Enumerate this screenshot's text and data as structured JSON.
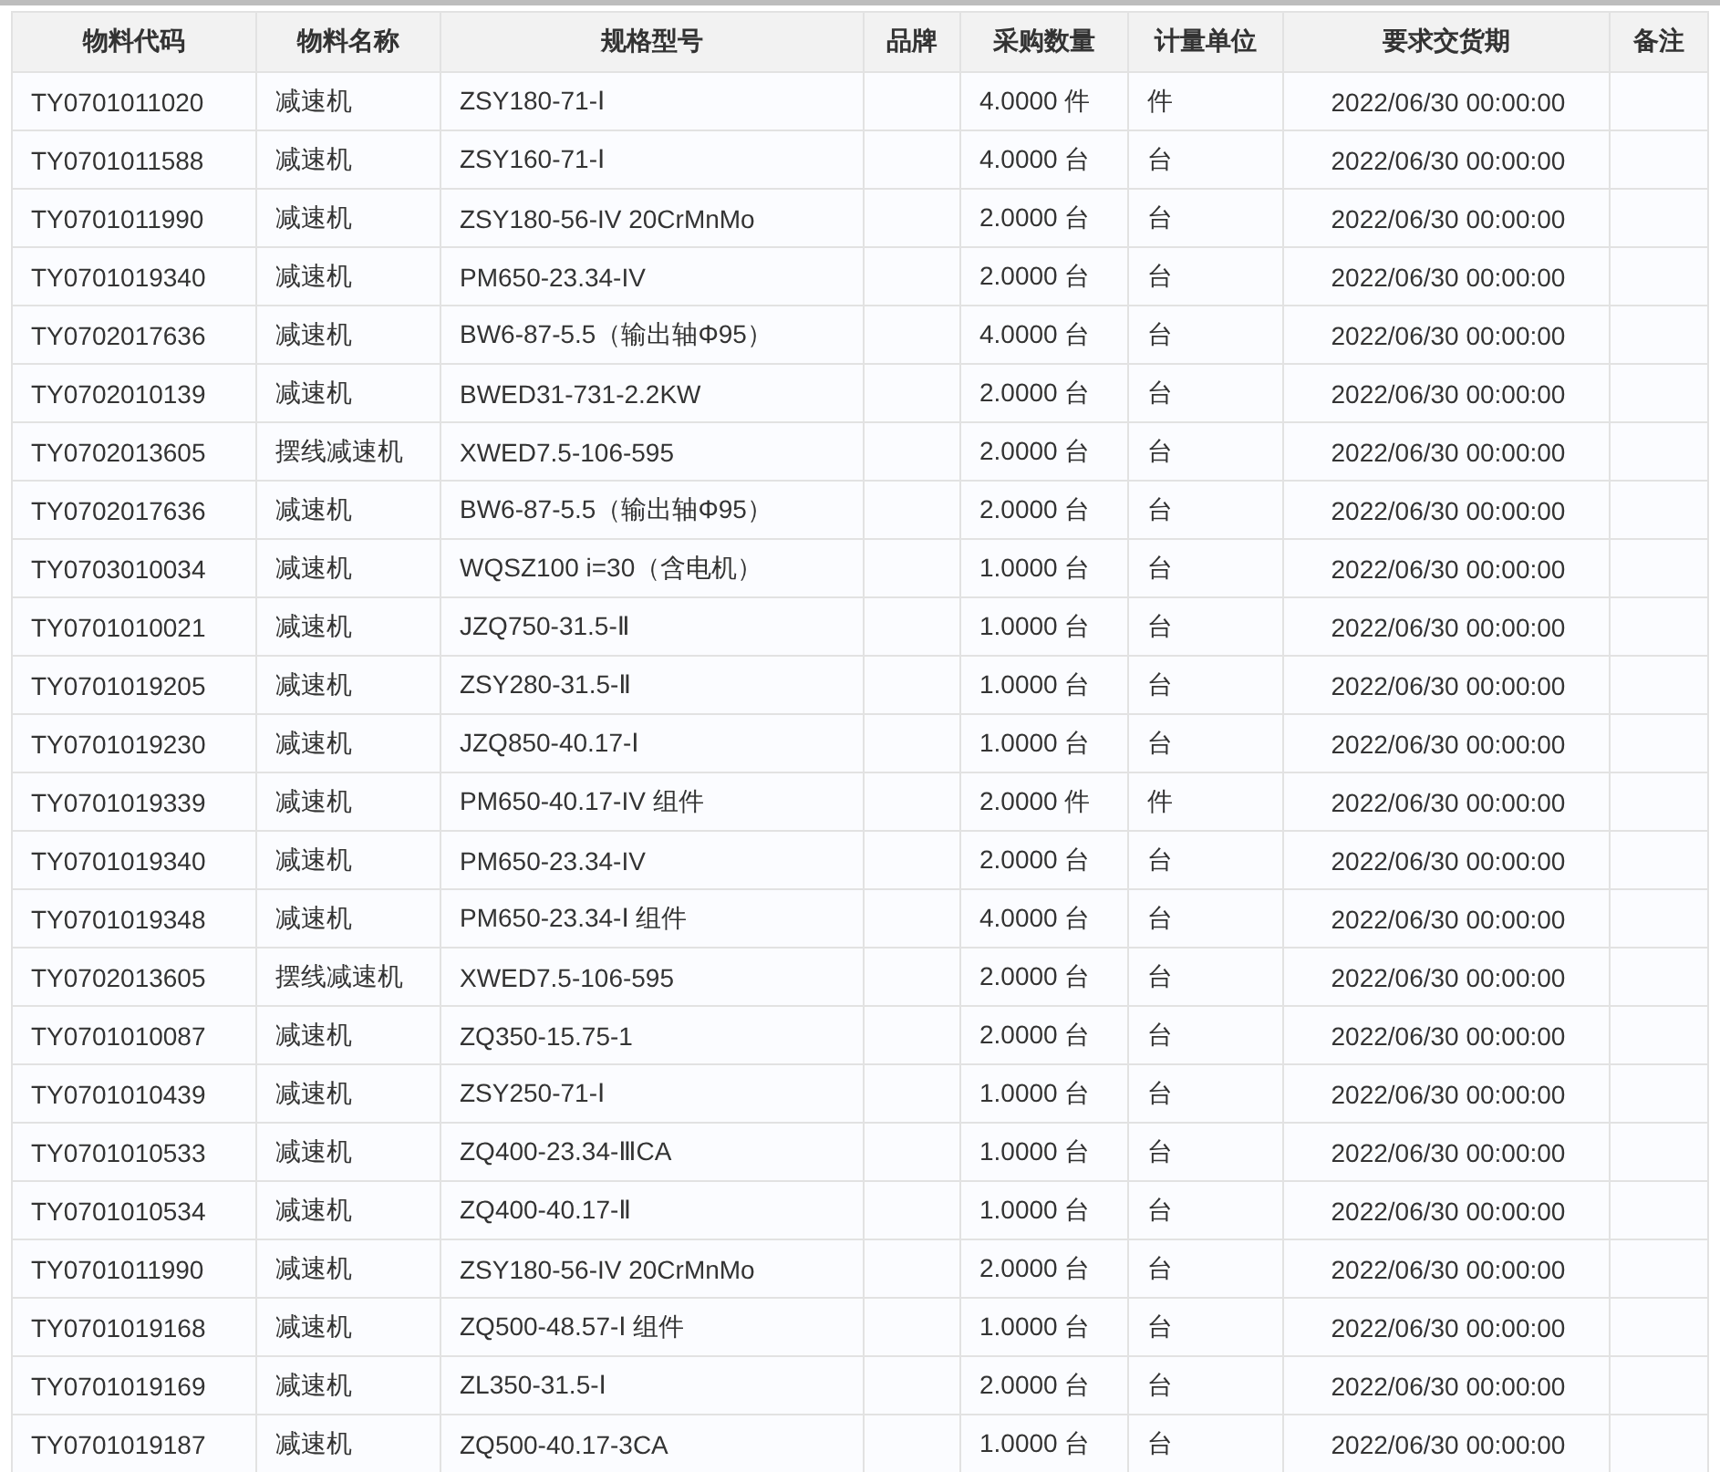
{
  "table": {
    "columns": [
      "物料代码",
      "物料名称",
      "规格型号",
      "品牌",
      "采购数量",
      "计量单位",
      "要求交货期",
      "备注"
    ],
    "rows": [
      {
        "code": "TY0701011020",
        "name": "减速机",
        "spec": "ZSY180-71-Ⅰ",
        "quantity": "4.0000 件",
        "unit": "件",
        "due": "2022/06/30 00:00:00"
      },
      {
        "code": "TY0701011588",
        "name": "减速机",
        "spec": "ZSY160-71-Ⅰ",
        "quantity": "4.0000 台",
        "unit": "台",
        "due": "2022/06/30 00:00:00"
      },
      {
        "code": "TY0701011990",
        "name": "减速机",
        "spec": "ZSY180-56-IV 20CrMnMo",
        "quantity": "2.0000 台",
        "unit": "台",
        "due": "2022/06/30 00:00:00"
      },
      {
        "code": "TY0701019340",
        "name": "减速机",
        "spec": "PM650-23.34-IV",
        "quantity": "2.0000 台",
        "unit": "台",
        "due": "2022/06/30 00:00:00"
      },
      {
        "code": "TY0702017636",
        "name": "减速机",
        "spec": "BW6-87-5.5（输出轴Φ95）",
        "quantity": "4.0000 台",
        "unit": "台",
        "due": "2022/06/30 00:00:00"
      },
      {
        "code": "TY0702010139",
        "name": "减速机",
        "spec": "BWED31-731-2.2KW",
        "quantity": "2.0000 台",
        "unit": "台",
        "due": "2022/06/30 00:00:00"
      },
      {
        "code": "TY0702013605",
        "name": "摆线减速机",
        "spec": "XWED7.5-106-595",
        "quantity": "2.0000 台",
        "unit": "台",
        "due": "2022/06/30 00:00:00"
      },
      {
        "code": "TY0702017636",
        "name": "减速机",
        "spec": "BW6-87-5.5（输出轴Φ95）",
        "quantity": "2.0000 台",
        "unit": "台",
        "due": "2022/06/30 00:00:00"
      },
      {
        "code": "TY0703010034",
        "name": "减速机",
        "spec": "WQSZ100 i=30（含电机）",
        "quantity": "1.0000 台",
        "unit": "台",
        "due": "2022/06/30 00:00:00"
      },
      {
        "code": "TY0701010021",
        "name": "减速机",
        "spec": "JZQ750-31.5-Ⅱ",
        "quantity": "1.0000 台",
        "unit": "台",
        "due": "2022/06/30 00:00:00"
      },
      {
        "code": "TY0701019205",
        "name": "减速机",
        "spec": "ZSY280-31.5-Ⅱ",
        "quantity": "1.0000 台",
        "unit": "台",
        "due": "2022/06/30 00:00:00"
      },
      {
        "code": "TY0701019230",
        "name": "减速机",
        "spec": "JZQ850-40.17-Ⅰ",
        "quantity": "1.0000 台",
        "unit": "台",
        "due": "2022/06/30 00:00:00"
      },
      {
        "code": "TY0701019339",
        "name": "减速机",
        "spec": "PM650-40.17-IV 组件",
        "quantity": "2.0000 件",
        "unit": "件",
        "due": "2022/06/30 00:00:00"
      },
      {
        "code": "TY0701019340",
        "name": "减速机",
        "spec": "PM650-23.34-IV",
        "quantity": "2.0000 台",
        "unit": "台",
        "due": "2022/06/30 00:00:00"
      },
      {
        "code": "TY0701019348",
        "name": "减速机",
        "spec": "PM650-23.34-Ⅰ 组件",
        "quantity": "4.0000 台",
        "unit": "台",
        "due": "2022/06/30 00:00:00"
      },
      {
        "code": "TY0702013605",
        "name": "摆线减速机",
        "spec": "XWED7.5-106-595",
        "quantity": "2.0000 台",
        "unit": "台",
        "due": "2022/06/30 00:00:00"
      },
      {
        "code": "TY0701010087",
        "name": "减速机",
        "spec": "ZQ350-15.75-1",
        "quantity": "2.0000 台",
        "unit": "台",
        "due": "2022/06/30 00:00:00"
      },
      {
        "code": "TY0701010439",
        "name": "减速机",
        "spec": "ZSY250-71-Ⅰ",
        "quantity": "1.0000 台",
        "unit": "台",
        "due": "2022/06/30 00:00:00"
      },
      {
        "code": "TY0701010533",
        "name": "减速机",
        "spec": "ZQ400-23.34-ⅢCA",
        "quantity": "1.0000 台",
        "unit": "台",
        "due": "2022/06/30 00:00:00"
      },
      {
        "code": "TY0701010534",
        "name": "减速机",
        "spec": "ZQ400-40.17-Ⅱ",
        "quantity": "1.0000 台",
        "unit": "台",
        "due": "2022/06/30 00:00:00"
      },
      {
        "code": "TY0701011990",
        "name": "减速机",
        "spec": "ZSY180-56-IV 20CrMnMo",
        "quantity": "2.0000 台",
        "unit": "台",
        "due": "2022/06/30 00:00:00"
      },
      {
        "code": "TY0701019168",
        "name": "减速机",
        "spec": "ZQ500-48.57-Ⅰ 组件",
        "quantity": "1.0000 台",
        "unit": "台",
        "due": "2022/06/30 00:00:00"
      },
      {
        "code": "TY0701019169",
        "name": "减速机",
        "spec": "ZL350-31.5-Ⅰ",
        "quantity": "2.0000 台",
        "unit": "台",
        "due": "2022/06/30 00:00:00"
      },
      {
        "code": "TY0701019187",
        "name": "减速机",
        "spec": "ZQ500-40.17-3CA",
        "quantity": "1.0000 台",
        "unit": "台",
        "due": "2022/06/30 00:00:00"
      }
    ]
  }
}
